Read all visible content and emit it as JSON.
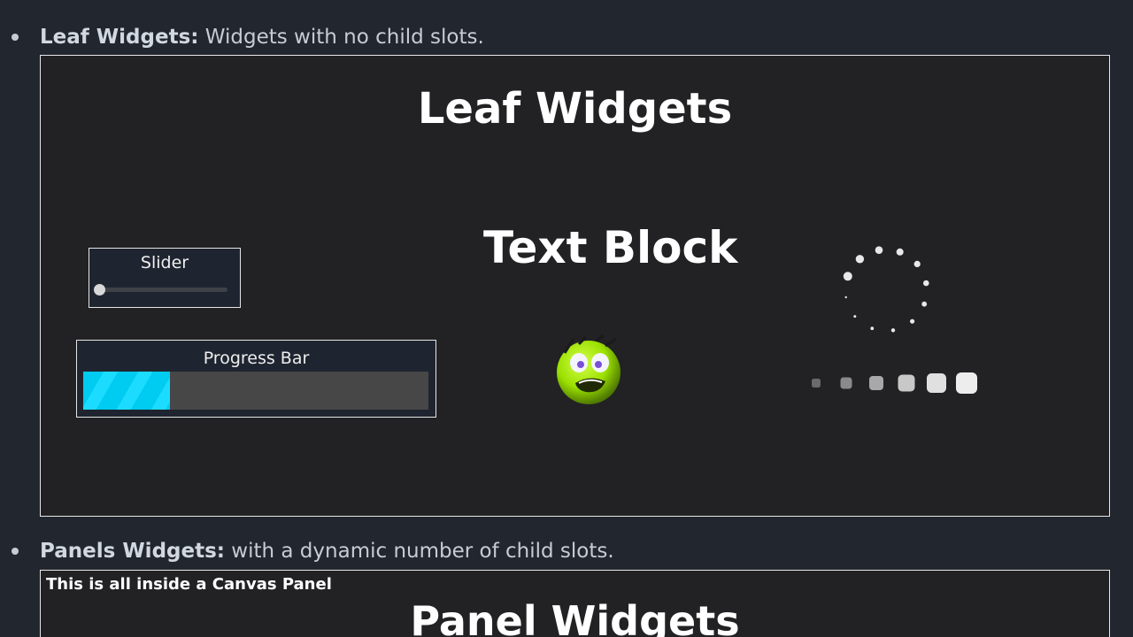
{
  "sections": [
    {
      "bullet_term": "Leaf Widgets:",
      "bullet_desc": "Widgets with no child slots.",
      "panel_title": "Leaf Widgets",
      "slider": {
        "label": "Slider",
        "value": 0.0
      },
      "progress_bar": {
        "label": "Progress Bar",
        "percent": 25
      },
      "text_block": "Text Block"
    },
    {
      "bullet_term": "Panels Widgets:",
      "bullet_desc": "with a dynamic number of child slots.",
      "panel_caption": "This is all inside a Canvas Panel",
      "panel_title": "Panel Widgets"
    }
  ],
  "colors": {
    "page_bg": "#22262f",
    "panel_bg": "#222224",
    "progress_fill": "#00cbf0",
    "progress_track": "#474747",
    "smiley": "#9be000"
  },
  "icons": [
    "bullet-dot",
    "emoji-face-icon",
    "throbber-circular-icon",
    "throbber-dots-icon"
  ]
}
